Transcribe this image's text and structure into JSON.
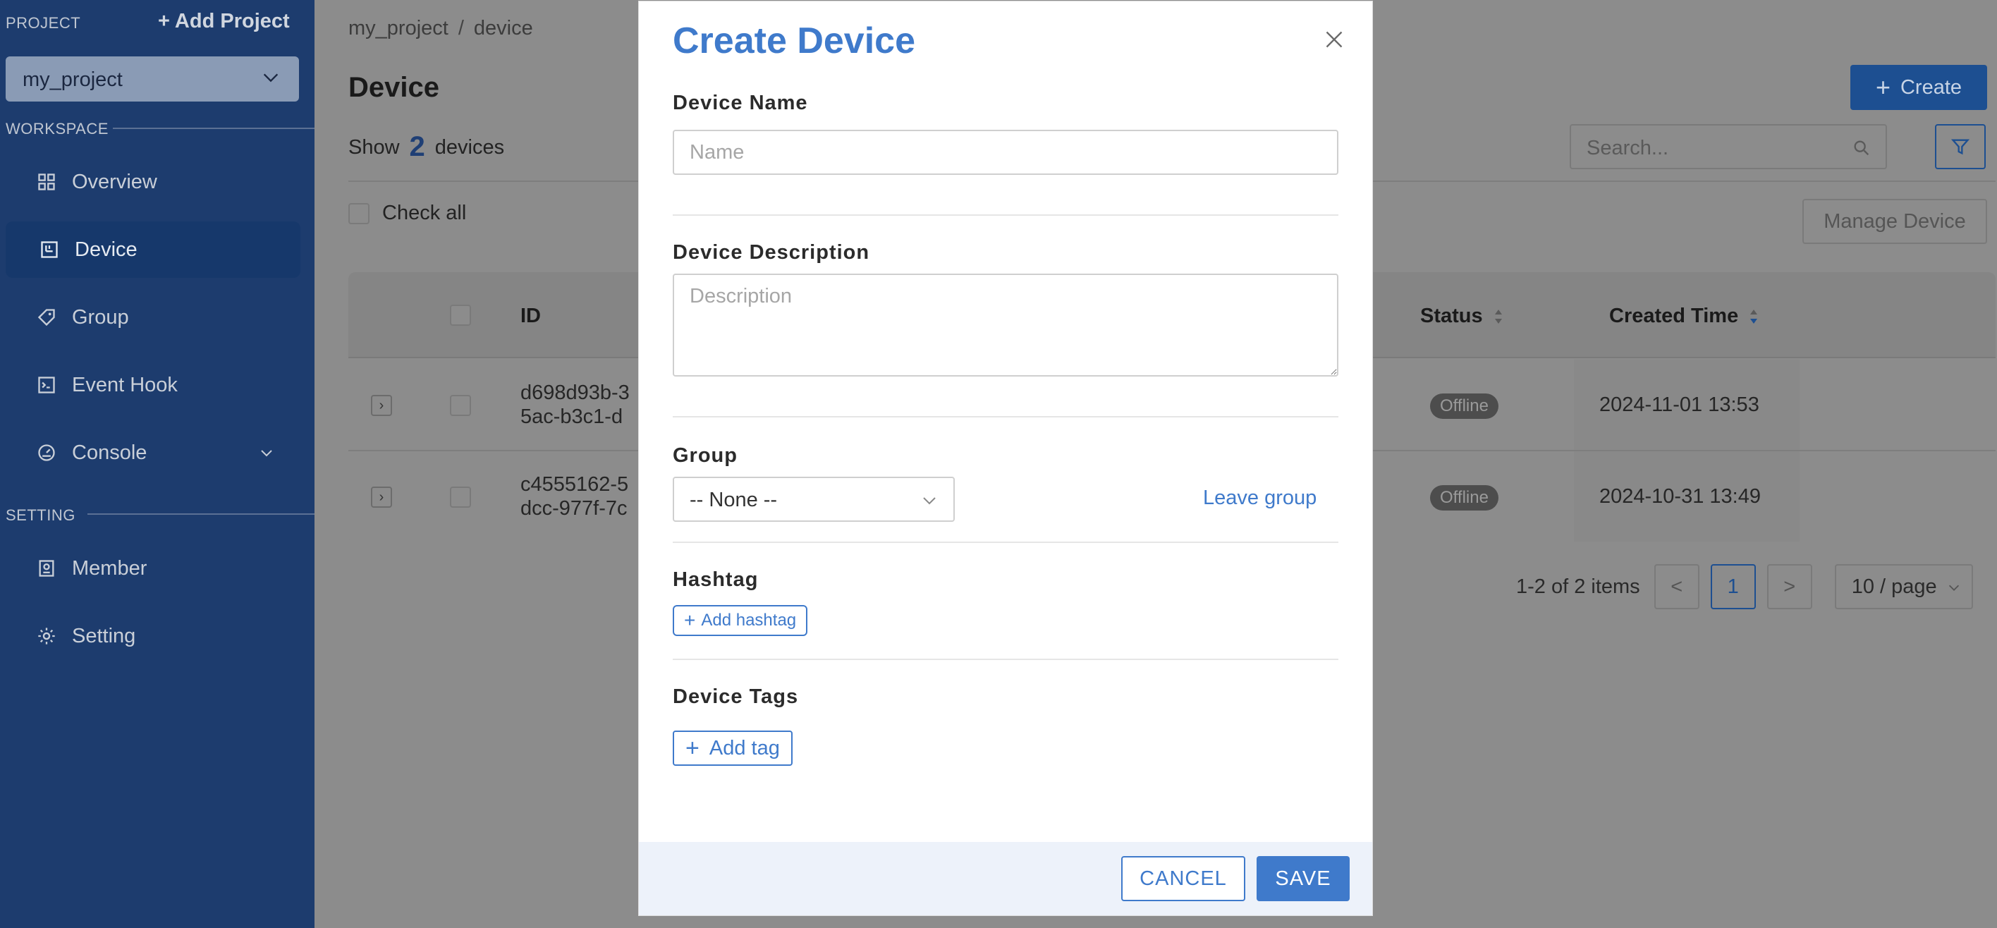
{
  "sidebar": {
    "project_label": "PROJECT",
    "add_project": "+ Add Project",
    "project_select": "my_project",
    "workspace_label": "WORKSPACE",
    "setting_label": "SETTING",
    "items": [
      {
        "label": "Overview",
        "icon": "grid-icon"
      },
      {
        "label": "Device",
        "icon": "device-icon"
      },
      {
        "label": "Group",
        "icon": "tag-icon"
      },
      {
        "label": "Event Hook",
        "icon": "terminal-icon"
      },
      {
        "label": "Console",
        "icon": "gauge-icon"
      },
      {
        "label": "Member",
        "icon": "member-icon"
      },
      {
        "label": "Setting",
        "icon": "gear-icon"
      }
    ]
  },
  "main": {
    "breadcrumb": [
      "my_project",
      "device"
    ],
    "breadcrumb_sep": "/",
    "title": "Device",
    "show_prefix": "Show",
    "device_count": "2",
    "show_suffix": "devices",
    "check_all": "Check all",
    "create_label": "Create",
    "search_placeholder": "Search...",
    "manage_device": "Manage Device",
    "table": {
      "headers": {
        "id": "ID",
        "status": "Status",
        "created": "Created Time"
      },
      "rows": [
        {
          "id_line1": "d698d93b-3",
          "id_line2": "5ac-b3c1-d",
          "status": "Offline",
          "created": "2024-11-01 13:53"
        },
        {
          "id_line1": "c4555162-5",
          "id_line2": "dcc-977f-7c",
          "status": "Offline",
          "created": "2024-10-31 13:49"
        }
      ]
    },
    "pagination": {
      "summary": "1-2 of 2 items",
      "prev": "<",
      "current": "1",
      "next": ">",
      "page_size": "10 / page"
    }
  },
  "modal": {
    "title": "Create Device",
    "device_name_label": "Device Name",
    "device_name_placeholder": "Name",
    "device_name_value": "",
    "description_label": "Device Description",
    "description_placeholder": "Description",
    "group_label": "Group",
    "group_value": "-- None --",
    "leave_group": "Leave group",
    "hashtag_label": "Hashtag",
    "add_hashtag": "Add hashtag",
    "tags_label": "Device Tags",
    "add_tag": "Add tag",
    "cancel": "CANCEL",
    "save": "SAVE"
  },
  "colors": {
    "accent": "#3f7acb",
    "sidebar_bg": "#1d3c6e",
    "overlay": "#8c8c8c",
    "footer_bg": "#edf2fa"
  }
}
